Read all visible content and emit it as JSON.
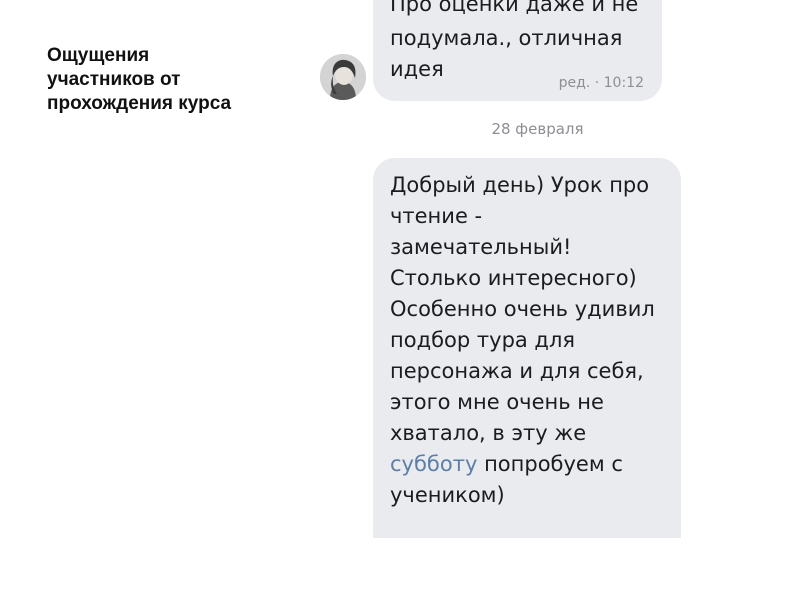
{
  "slide": {
    "title_lines": [
      "Ощущения",
      "участников от",
      "прохождения курса"
    ]
  },
  "chat": {
    "previous_message": {
      "cut_off_line": "Про оценки даже и не",
      "lines": [
        "подумала., отличная",
        "идея"
      ],
      "meta": "ред. · 10:12"
    },
    "date_divider": "28 февраля",
    "message": {
      "lines": [
        "Добрый день) Урок про",
        "чтение -",
        "замечательный!",
        "Столько интересного)",
        "Особенно очень удивил",
        "подбор тура для",
        "персонажа и для себя,",
        "этого мне очень не",
        "хватало, в эту же"
      ],
      "link_text": "субботу",
      "link_tail": " попробуем с",
      "last_line": "учеником)"
    }
  },
  "colors": {
    "bubble_bg": "#e9ebef",
    "link": "#5c7ea8",
    "meta_text": "#8e8e93"
  },
  "icons": {
    "avatar": "user-avatar-photo"
  }
}
